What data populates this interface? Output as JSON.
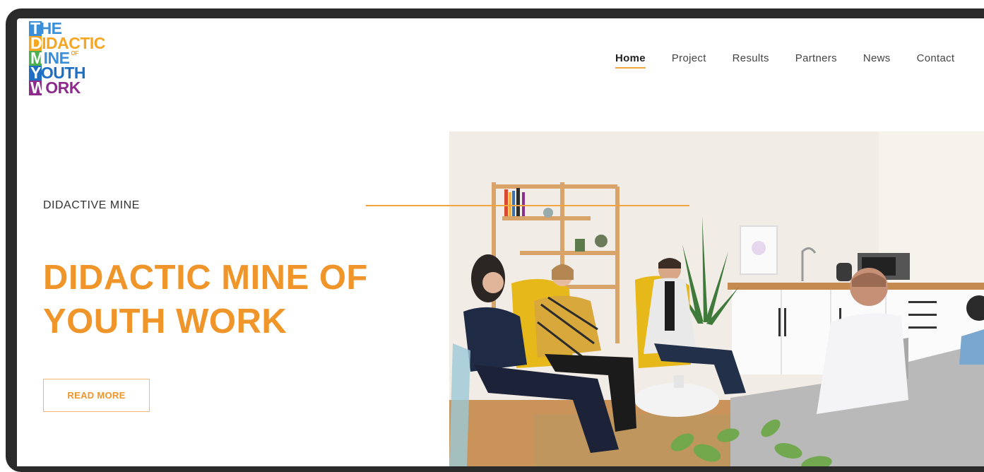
{
  "logo": {
    "rows": [
      {
        "block_color": "#3a8fd8",
        "letter": "T",
        "rest": "HE",
        "text_color": "#3a8fd8"
      },
      {
        "block_color": "#f5a623",
        "letter": "D",
        "rest": "IDACTIC",
        "text_color": "#f5a623"
      },
      {
        "block_color": "#4caf50",
        "letter": "M",
        "rest": "INE",
        "text_color": "#3a8fd8"
      },
      {
        "block_color": "#1e6fc4",
        "letter": "Y",
        "rest": "OUTH",
        "text_color": "#1e6fc4"
      },
      {
        "block_color": "#8e2c8e",
        "letter": "W",
        "rest": "ORK",
        "text_color": "#8e2c8e"
      }
    ],
    "of_text": "OF"
  },
  "nav": {
    "items": [
      {
        "label": "Home",
        "active": true
      },
      {
        "label": "Project",
        "active": false
      },
      {
        "label": "Results",
        "active": false
      },
      {
        "label": "Partners",
        "active": false
      },
      {
        "label": "News",
        "active": false
      },
      {
        "label": "Contact",
        "active": false
      }
    ]
  },
  "hero": {
    "eyebrow": "DIDACTIVE MINE",
    "headline_line1": "DIDACTIC MINE OF",
    "headline_line2": "YOUTH WORK",
    "cta_label": "READ MORE"
  },
  "colors": {
    "accent": "#f0952a",
    "frame": "#2a2a2a"
  }
}
